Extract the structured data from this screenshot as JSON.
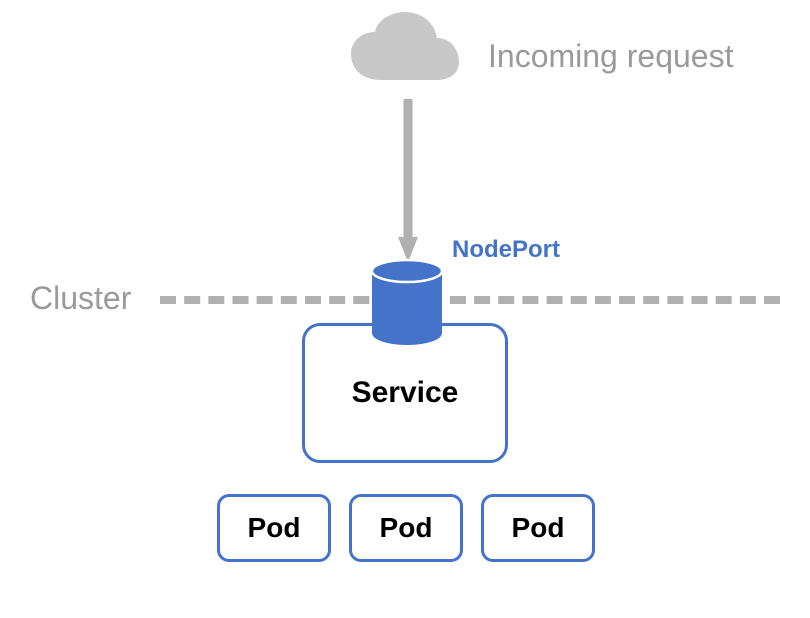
{
  "incoming_label": "Incoming request",
  "cluster_label": "Cluster",
  "nodeport_label": "NodePort",
  "service_label": "Service",
  "pods": [
    "Pod",
    "Pod",
    "Pod"
  ],
  "colors": {
    "gray": "#9a9a9a",
    "blue_border": "#4573c9",
    "blue_fill": "#4573c9",
    "cloud": "#c8c8c8",
    "arrow": "#b0b0b0"
  }
}
